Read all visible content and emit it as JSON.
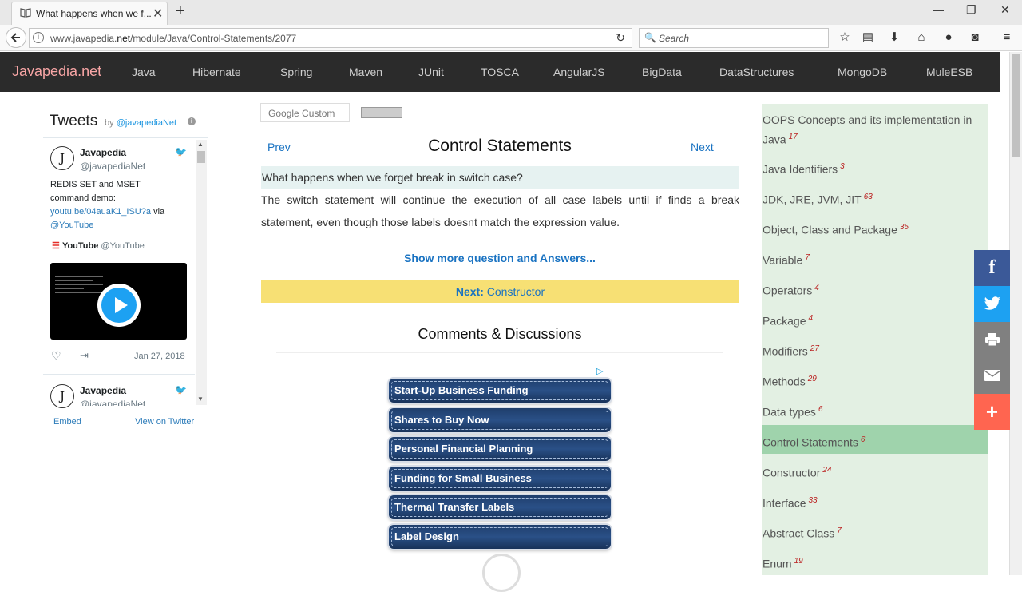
{
  "browser": {
    "tab_title": "What happens when we f...",
    "url_prefix": "www.javapedia.",
    "url_host": "net",
    "url_path": "/module/Java/Control-Statements/2077",
    "search_placeholder": "Search"
  },
  "site": {
    "logo": "Javapedia.net",
    "menu": [
      "Java",
      "Hibernate",
      "Spring",
      "Maven",
      "JUnit",
      "TOSCA",
      "AngularJS",
      "BigData",
      "DataStructures",
      "MongoDB",
      "MuleESB"
    ]
  },
  "twitter": {
    "title": "Tweets",
    "by": "by",
    "by_handle": "@javapediaNet",
    "tweet1": {
      "name": "Javapedia",
      "handle": "@javapediaNet",
      "text_line1": "REDIS SET and MSET",
      "text_line2": "command demo:",
      "link": "youtu.be/04auaK1_ISU?a",
      "via": "via",
      "via_handle": "@YouTube",
      "card_source": "YouTube",
      "card_handle": "@YouTube",
      "date": "Jan 27, 2018"
    },
    "tweet2": {
      "name": "Javapedia",
      "handle": "@javapediaNet"
    },
    "embed": "Embed",
    "view_on": "View on Twitter"
  },
  "main": {
    "search_label": "Google Custom",
    "prev": "Prev",
    "next": "Next",
    "title": "Control Statements",
    "question": "What happens when we forget break in switch case?",
    "answer": "The switch statement will continue the execution of all case labels until if finds a break statement, even though those labels doesnt match the expression value.",
    "show_more": "Show more question and Answers...",
    "next_label": "Next:",
    "next_topic": "Constructor",
    "comments_title": "Comments & Discussions",
    "ads": [
      "Start-Up Business Funding",
      "Shares to Buy Now",
      "Personal Financial Planning",
      "Funding for Small Business",
      "Thermal Transfer Labels",
      "Label Design"
    ]
  },
  "sidebar": {
    "items": [
      {
        "label": "OOPS Concepts and its implementation in Java",
        "count": "17"
      },
      {
        "label": "Java Identifiers",
        "count": "3"
      },
      {
        "label": "JDK, JRE, JVM, JIT",
        "count": "63"
      },
      {
        "label": "Object, Class and Package",
        "count": "35"
      },
      {
        "label": "Variable",
        "count": "7"
      },
      {
        "label": "Operators",
        "count": "4"
      },
      {
        "label": "Package",
        "count": "4"
      },
      {
        "label": "Modifiers",
        "count": "27"
      },
      {
        "label": "Methods",
        "count": "29"
      },
      {
        "label": "Data types",
        "count": "6"
      },
      {
        "label": "Control Statements",
        "count": "6"
      },
      {
        "label": "Constructor",
        "count": "24"
      },
      {
        "label": "Interface",
        "count": "33"
      },
      {
        "label": "Abstract Class",
        "count": "7"
      },
      {
        "label": "Enum",
        "count": "19"
      }
    ],
    "active": "Control Statements"
  },
  "share": {
    "colors": {
      "facebook": "#3b5998",
      "twitter": "#1da1f2",
      "print": "#808080",
      "email": "#808080",
      "more": "#ff6550"
    }
  }
}
